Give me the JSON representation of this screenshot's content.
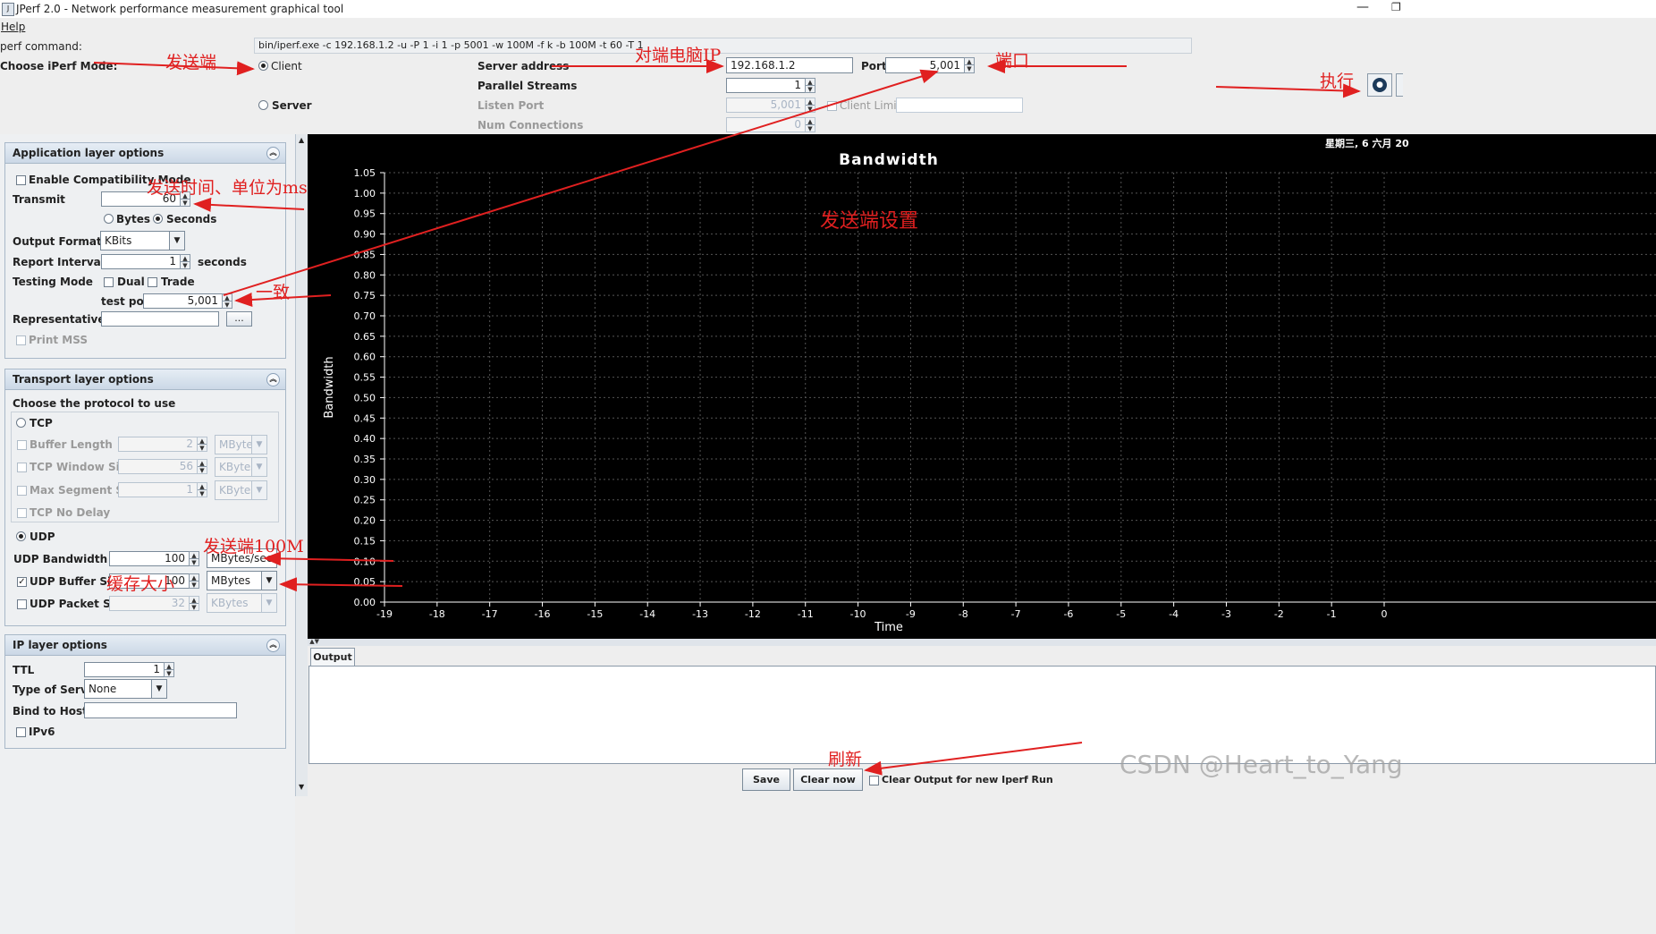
{
  "window": {
    "title": "JPerf 2.0 - Network performance measurement graphical tool",
    "menu_help": "Help"
  },
  "command": {
    "label": "perf command:",
    "value": "bin/iperf.exe -c 192.168.1.2 -u -P 1 -i 1 -p 5001 -w 100M -f k -b 100M -t 60 -T 1"
  },
  "mode": {
    "label": "Choose iPerf Mode:",
    "client_label": "Client",
    "server_label": "Server",
    "selected": "Client",
    "server_address_label": "Server address",
    "server_address_value": "192.168.1.2",
    "port_label": "Port",
    "port_value": "5,001",
    "parallel_label": "Parallel Streams",
    "parallel_value": "1",
    "listen_port_label": "Listen Port",
    "listen_port_value": "5,001",
    "client_limit_label": "Client Limit",
    "num_connections_label": "Num Connections",
    "num_connections_value": "0"
  },
  "app_layer": {
    "title": "Application layer options",
    "compat_label": "Enable Compatibility Mode",
    "transmit_label": "Transmit",
    "transmit_value": "60",
    "bytes_label": "Bytes",
    "seconds_label": "Seconds",
    "transmit_unit_selected": "Seconds",
    "output_format_label": "Output Format",
    "output_format_value": "KBits",
    "report_interval_label": "Report Interval",
    "report_interval_value": "1",
    "report_interval_unit": "seconds",
    "testing_mode_label": "Testing Mode",
    "dual_label": "Dual",
    "trade_label": "Trade",
    "test_port_label": "test port",
    "test_port_value": "5,001",
    "rep_file_label": "Representative File",
    "browse_label": "...",
    "print_mss_label": "Print MSS"
  },
  "transport": {
    "title": "Transport layer options",
    "protocol_label": "Choose the protocol to use",
    "tcp_label": "TCP",
    "buffer_length_label": "Buffer Length",
    "buffer_length_value": "2",
    "buffer_length_unit": "MBytes",
    "tcp_window_label": "TCP Window Size",
    "tcp_window_value": "56",
    "tcp_window_unit": "KBytes",
    "max_segment_label": "Max Segment Size",
    "max_segment_value": "1",
    "max_segment_unit": "KBytes",
    "tcp_nodelay_label": "TCP No Delay",
    "udp_label": "UDP",
    "protocol_selected": "UDP",
    "udp_bandwidth_label": "UDP Bandwidth",
    "udp_bandwidth_value": "100",
    "udp_bandwidth_unit": "MBytes/sec",
    "udp_buffer_label": "UDP Buffer Size",
    "udp_buffer_value": "100",
    "udp_buffer_unit": "MBytes",
    "udp_packet_label": "UDP Packet Size",
    "udp_packet_value": "32",
    "udp_packet_unit": "KBytes"
  },
  "ip_layer": {
    "title": "IP layer options",
    "ttl_label": "TTL",
    "ttl_value": "1",
    "tos_label": "Type of Service",
    "tos_value": "None",
    "bind_label": "Bind to Host",
    "ipv6_label": "IPv6"
  },
  "output": {
    "tab_label": "Output",
    "save_label": "Save",
    "clear_label": "Clear now",
    "clear_new_label": "Clear Output for new Iperf Run"
  },
  "date_text": "星期三, 6 六月 20",
  "chart_data": {
    "type": "line",
    "title": "Bandwidth",
    "xlabel": "Time",
    "ylabel": "Bandwidth",
    "x_ticks": [
      "-19",
      "-18",
      "-17",
      "-16",
      "-15",
      "-14",
      "-13",
      "-12",
      "-11",
      "-10",
      "-9",
      "-8",
      "-7",
      "-6",
      "-5",
      "-4",
      "-3",
      "-2",
      "-1",
      "0"
    ],
    "y_ticks": [
      "0.00",
      "0.05",
      "0.10",
      "0.15",
      "0.20",
      "0.25",
      "0.30",
      "0.35",
      "0.40",
      "0.45",
      "0.50",
      "0.55",
      "0.60",
      "0.65",
      "0.70",
      "0.75",
      "0.80",
      "0.85",
      "0.90",
      "0.95",
      "1.00",
      "1.05"
    ],
    "xlim": [
      -19,
      0
    ],
    "ylim": [
      0,
      1.05
    ],
    "grid": true,
    "series": []
  },
  "annotations": {
    "sender": "发送端",
    "peer_ip": "对端电脑IP",
    "port": "端口",
    "execute": "执行",
    "send_time": "发送时间、单位为ms",
    "sender_setup": "发送端设置",
    "consistent": "一致",
    "sender_100m": "发送端100M",
    "buffer_size": "缓存大小",
    "refresh": "刷新",
    "watermark": "CSDN @Heart_to_Yang"
  },
  "colors": {
    "annotation": "#e02020",
    "chart_bg": "#000000",
    "chart_fg": "#ffffff"
  }
}
